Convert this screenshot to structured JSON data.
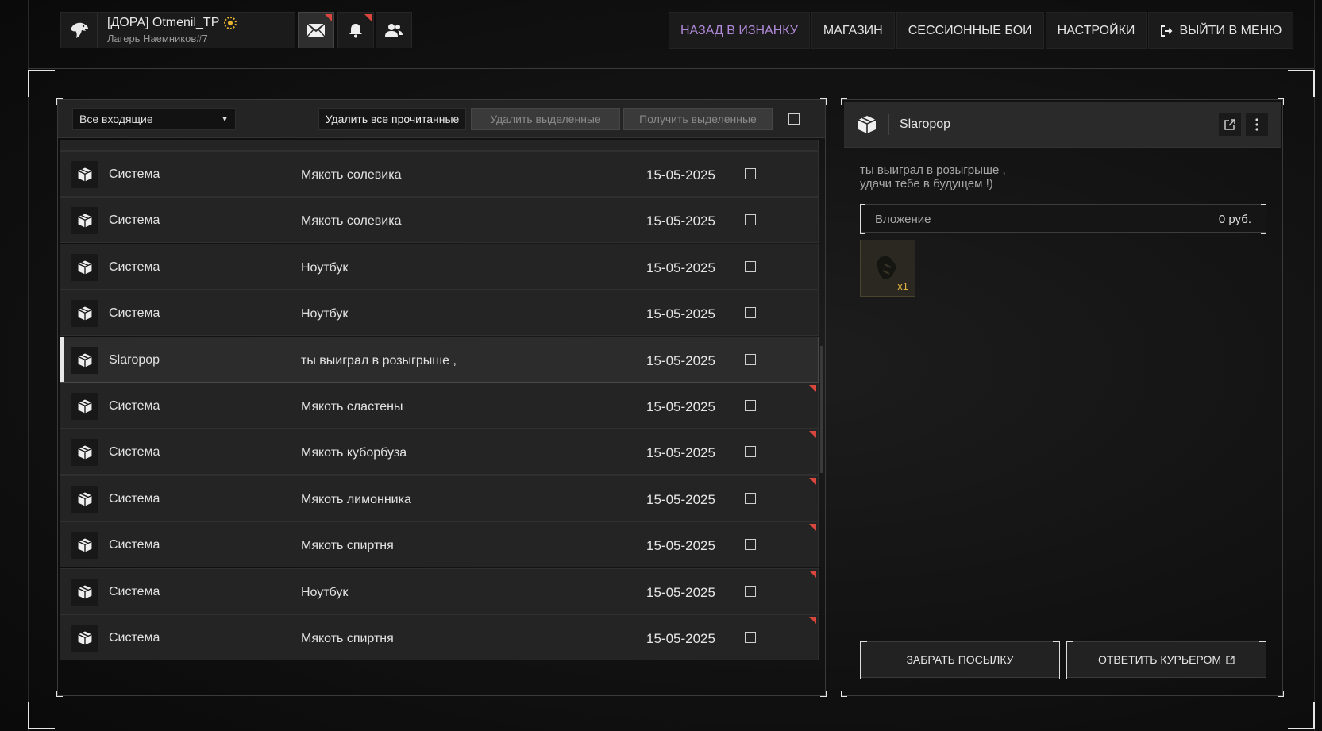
{
  "profile": {
    "nickname": "[ДОРА] Otmenil_TP",
    "camp": "Лагерь Наемников#7"
  },
  "nav": {
    "back": "НАЗАД В ИЗНАНКУ",
    "shop": "МАГАЗИН",
    "session_battles": "СЕССИОННЫЕ БОИ",
    "settings": "НАСТРОЙКИ",
    "exit": "ВЫЙТИ В МЕНЮ"
  },
  "colors": {
    "accent_purple": "#b089d8",
    "unread_marker": "#d8463e",
    "item_qty": "#e0b040"
  },
  "toolbar": {
    "filter_value": "Все входящие",
    "delete_read": "Удалить все прочитанные",
    "delete_selected": "Удалить выделенные",
    "receive_selected": "Получить выделенные"
  },
  "mails": [
    {
      "sender": "Система",
      "subject": "Мякоть солевика",
      "date": "15-05-2025",
      "unread": false,
      "selected": false
    },
    {
      "sender": "Система",
      "subject": "Мякоть солевика",
      "date": "15-05-2025",
      "unread": false,
      "selected": false
    },
    {
      "sender": "Система",
      "subject": "Ноутбук",
      "date": "15-05-2025",
      "unread": false,
      "selected": false
    },
    {
      "sender": "Система",
      "subject": "Ноутбук",
      "date": "15-05-2025",
      "unread": false,
      "selected": false
    },
    {
      "sender": "Slaropop",
      "subject": "ты выиграл в розыгрыше ,",
      "date": "15-05-2025",
      "unread": false,
      "selected": true
    },
    {
      "sender": "Система",
      "subject": "Мякоть сластены",
      "date": "15-05-2025",
      "unread": true,
      "selected": false
    },
    {
      "sender": "Система",
      "subject": "Мякоть куборбуза",
      "date": "15-05-2025",
      "unread": true,
      "selected": false
    },
    {
      "sender": "Система",
      "subject": "Мякоть лимонника",
      "date": "15-05-2025",
      "unread": true,
      "selected": false
    },
    {
      "sender": "Система",
      "subject": "Мякоть спиртня",
      "date": "15-05-2025",
      "unread": true,
      "selected": false
    },
    {
      "sender": "Система",
      "subject": "Ноутбук",
      "date": "15-05-2025",
      "unread": true,
      "selected": false
    },
    {
      "sender": "Система",
      "subject": "Мякоть спиртня",
      "date": "15-05-2025",
      "unread": true,
      "selected": false
    }
  ],
  "detail": {
    "sender": "Slaropop",
    "body": "ты выиграл в розыгрыше ,\nудачи тебе в будущем !)",
    "attachment_label": "Вложение",
    "attachment_value": "0  руб.",
    "item_qty": "x1",
    "take_button": "ЗАБРАТЬ ПОСЫЛКУ",
    "reply_button": "ОТВЕТИТЬ КУРЬЕРОМ"
  }
}
